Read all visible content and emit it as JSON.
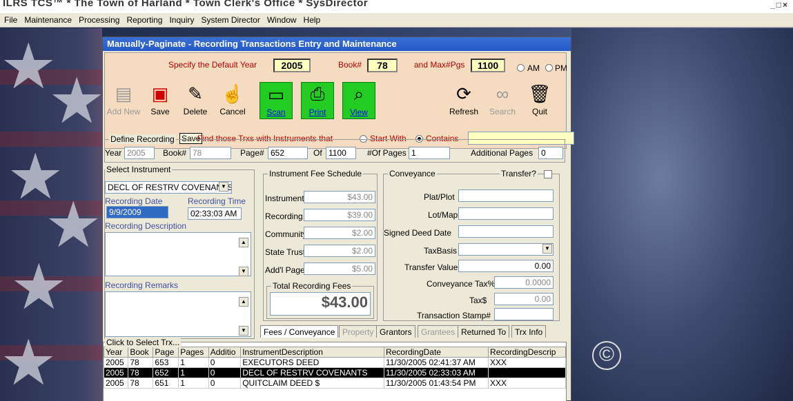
{
  "window_title": "ILRS TCS™ * The Town of Harland * Town Clerk's Office * SysDirector",
  "window_controls": "_□×",
  "menu": [
    "File",
    "Maintenance",
    "Processing",
    "Reporting",
    "Inquiry",
    "System Director",
    "Window",
    "Help"
  ],
  "form": {
    "title": "Manually-Paginate - Recording Transactions Entry and Maintenance",
    "default_year_label": "Specify the Default Year",
    "default_year": "2005",
    "book_label": "Book#",
    "book": "78",
    "maxpgs_label": "and Max#Pgs",
    "maxpgs": "1100",
    "am_label": "AM",
    "pm_label": "PM",
    "toolbar": {
      "add_new": "Add New",
      "save": "Save",
      "delete": "Delete",
      "cancel": "Cancel",
      "scan": "Scan",
      "print": "Print",
      "view": "View",
      "refresh": "Refresh",
      "search": "Search",
      "quit": "Quit"
    },
    "tooltip": "Save",
    "find_label": "Find those Trxs with Instruments that",
    "start_with": "Start With",
    "contains": "Contains",
    "find_value": ""
  },
  "define_recording": {
    "title": "Define Recording",
    "year_label": "Year",
    "year": "2005",
    "book_label": "Book#",
    "book": "78",
    "page_label": "Page#",
    "page": "652",
    "of_label": "Of",
    "of": "1100",
    "numpages_label": "#Of Pages",
    "numpages": "1",
    "additional_label": "Additional Pages",
    "additional": "0"
  },
  "select_instrument": {
    "title": "Select Instrument",
    "selected": "DECL OF RESTRV COVENANTS",
    "rec_date_label": "Recording Date",
    "rec_date": "9/9/2009",
    "rec_time_label": "Recording Time",
    "rec_time": "02:33:03 AM",
    "description_label": "Recording Description",
    "remarks_label": "Recording Remarks"
  },
  "fee_schedule": {
    "title": "Instrument Fee Schedule",
    "instrument_label": "Instrument",
    "instrument": "$43.00",
    "recording_label": "Recording",
    "recording": "$39.00",
    "community_label": "Community",
    "community": "$2.00",
    "state_trust_label": "State Trust",
    "state_trust": "$2.00",
    "addl_page_label": "Add'l Page",
    "addl_page": "$5.00",
    "total_label": "Total Recording Fees",
    "total": "$43.00"
  },
  "conveyance": {
    "title": "Conveyance",
    "transfer_label": "Transfer?",
    "plat_label": "Plat/Plot",
    "plat": "",
    "lot_label": "Lot/Map",
    "lot": "",
    "signed_label": "Signed Deed Date",
    "signed": "",
    "taxbasis_label": "TaxBasis",
    "taxbasis": "",
    "transfer_value_label": "Transfer Value",
    "transfer_value": "0.00",
    "conv_tax_label": "Conveyance Tax%",
    "conv_tax": "0.0000",
    "tax_label": "Tax$",
    "tax": "0.00",
    "stamp_label": "Transaction Stamp#",
    "stamp": ""
  },
  "tabs": [
    "Fees / Conveyance",
    "Property",
    "Grantors",
    "Grantees",
    "Returned To",
    "Trx Info"
  ],
  "grid": {
    "title": "Click to Select Trx...",
    "columns": [
      "Year",
      "Book",
      "Page",
      "Pages",
      "Additio",
      "InstrumentDescription",
      "RecordingDate",
      "RecordingDescrip"
    ],
    "rows": [
      [
        "2005",
        "78",
        "653",
        "1",
        "0",
        "EXECUTORS DEED",
        "11/30/2005 02:41:37 AM",
        "XXX"
      ],
      [
        "2005",
        "78",
        "652",
        "1",
        "0",
        "DECL OF RESTRV COVENANTS",
        "11/30/2005 02:33:03 AM",
        ""
      ],
      [
        "2005",
        "78",
        "651",
        "1",
        "0",
        "QUITCLAIM DEED $",
        "11/30/2005 01:43:54 PM",
        "XXX"
      ]
    ]
  },
  "watermark": "©"
}
